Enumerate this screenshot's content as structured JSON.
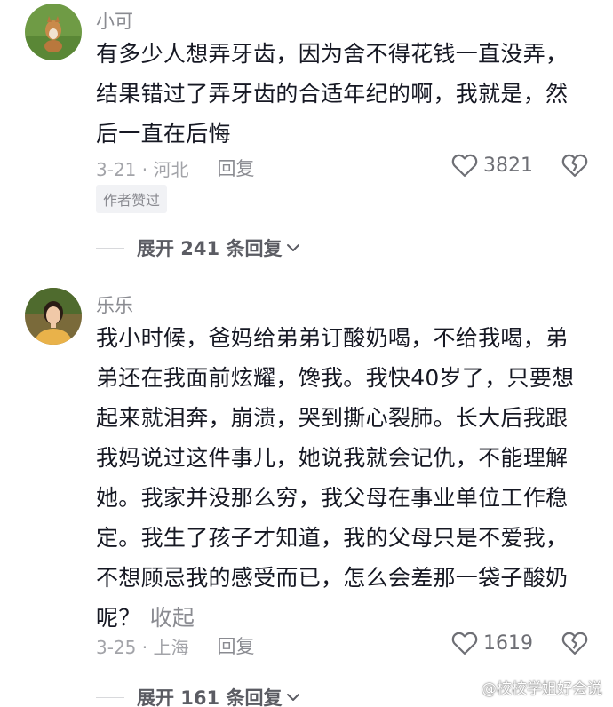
{
  "comments": [
    {
      "username": "小可",
      "text_lines": [
        "有多少人想弄牙齿，因为舍不得花钱一直没弄，",
        "结果错过了弄牙齿的合适年纪的啊，我就是，然",
        "后一直在后悔"
      ],
      "date_location": "3-21 · 河北",
      "reply_label": "回复",
      "likes": "3821",
      "badge": "作者赞过",
      "expand_label": "展开 241 条回复"
    },
    {
      "username": "乐乐",
      "text_lines": [
        "我小时候，爸妈给弟弟订酸奶喝，不给我喝，弟",
        "弟还在我面前炫耀，馋我。我快40岁了，只要想",
        "起来就泪奔，崩溃，哭到撕心裂肺。长大后我跟",
        "我妈说过这件事儿，她说我就会记仇，不能理解",
        "她。我家并没那么穷，我父母在事业单位工作稳",
        "定。我生了孩子才知道，我的父母只是不爱我，",
        "不想顾忌我的感受而已，怎么会差那一袋子酸奶",
        "呢？"
      ],
      "collapse_label": "收起",
      "date_location": "3-25 · 上海",
      "reply_label": "回复",
      "likes": "1619",
      "expand_label": "展开 161 条回复"
    }
  ],
  "watermark": "@校校学姐好会说",
  "icons": {
    "like": "heart-outline-icon",
    "dislike": "broken-heart-icon",
    "expand": "chevron-down-icon"
  }
}
